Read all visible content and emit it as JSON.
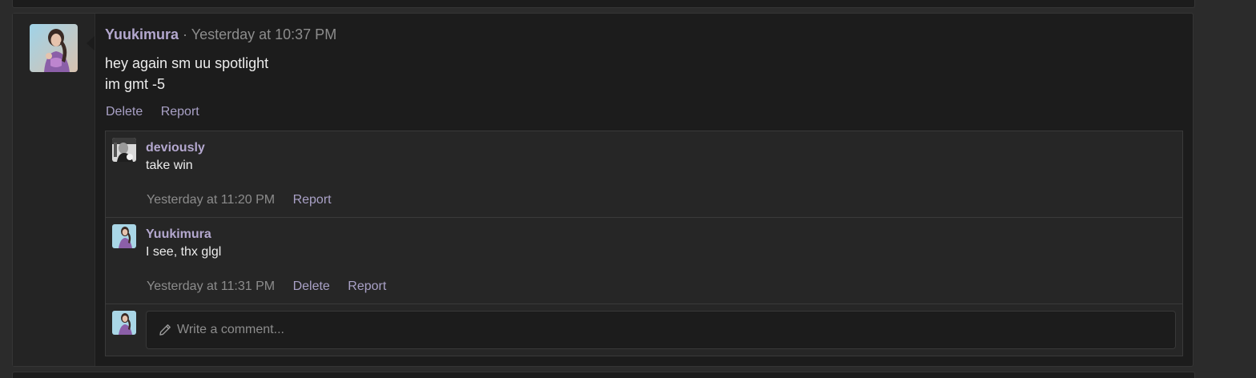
{
  "post": {
    "author": "Yuukimura",
    "separator": "·",
    "time": "Yesterday at 10:37 PM",
    "message_lines": [
      "hey again sm uu spotlight",
      "im gmt -5"
    ],
    "actions": {
      "delete": "Delete",
      "report": "Report"
    }
  },
  "comments": [
    {
      "author": "deviously",
      "text": "take win",
      "time": "Yesterday at 11:20 PM",
      "actions": {
        "report": "Report"
      }
    },
    {
      "author": "Yuukimura",
      "text": "I see, thx glgl",
      "time": "Yesterday at 11:31 PM",
      "actions": {
        "delete": "Delete",
        "report": "Report"
      }
    }
  ],
  "comment_box": {
    "placeholder": "Write a comment...",
    "icon": "pencil-icon"
  },
  "colors": {
    "background": "#2b2b2b",
    "card": "#1c1c1c",
    "username": "#b4a8cf",
    "link": "#a9a1c6",
    "muted": "#8c8c8c",
    "text": "#ececec"
  }
}
